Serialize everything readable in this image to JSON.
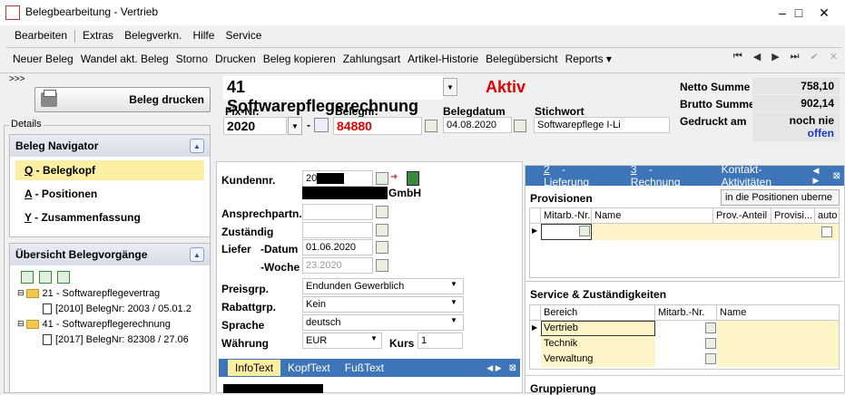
{
  "window": {
    "title": "Belegbearbeitung - Vertrieb",
    "minimize": "–",
    "maximize": "□",
    "close": "✕"
  },
  "menu": [
    "Bearbeiten",
    "Extras",
    "Belegverkn.",
    "Hilfe",
    "Service"
  ],
  "toolbar": [
    "Neuer Beleg",
    "Wandel akt. Beleg",
    "Storno",
    "Drucken",
    "Beleg kopieren",
    "Zahlungsart",
    "Artikel-Historie",
    "Belegübersicht",
    "Reports ▾"
  ],
  "nav": {
    "first": "⏮",
    "prev": "◀",
    "next": "▶",
    "last": "⏭",
    "ok": "✔",
    "cancel": "✕"
  },
  "left": {
    "expander": ">>>",
    "print_label": "Beleg drucken",
    "details_label": "Details",
    "navigator": {
      "title": "Beleg Navigator",
      "items": [
        {
          "key": "Q",
          "label": " - Belegkopf"
        },
        {
          "key": "A",
          "label": " - Positionen"
        },
        {
          "key": "Y",
          "label": " - Zusammenfassung"
        }
      ]
    },
    "overview": {
      "title": "Übersicht Belegvorgänge",
      "tree": [
        "21 - Softwarepflegevertrag",
        "[2010] BelegNr: 2003 / 05.01.2",
        "41 - Softwarepflegerechnung",
        "[2017] BelegNr: 82308 / 27.06"
      ]
    }
  },
  "header": {
    "doc_type": "41 Softwarepflegerechnung",
    "status": "Aktiv",
    "fix_label": "Fix-Nr.",
    "fix_value": "2020",
    "belegnr_label": "Belegnr.",
    "belegnr_value": "84880",
    "belegdatum_label": "Belegdatum",
    "belegdatum_value": "04.08.2020",
    "stichwort_label": "Stichwort",
    "stichwort_value": "Softwarepflege  I-Li",
    "dash": "-"
  },
  "sums": {
    "netto_label": "Netto Summe",
    "netto_value": "758,10",
    "brutto_label": "Brutto Summe",
    "brutto_value": "902,14",
    "gedruckt_label": "Gedruckt am",
    "gedruckt_value1": "noch nie",
    "gedruckt_value2": "offen"
  },
  "customer": {
    "kundennr_label": "Kundennr.",
    "kundennr_value": "20",
    "gmbh": "GmbH",
    "ansprech_label": "Ansprechpartn.",
    "zustaendig_label": "Zuständig",
    "liefer_label": "Liefer",
    "datum_label": "-Datum",
    "datum_value": "01.06.2020",
    "woche_label": "-Woche",
    "woche_value": "23.2020",
    "preisgrp_label": "Preisgrp.",
    "preisgrp_value": "Endunden Gewerblich",
    "rabattgrp_label": "Rabattgrp.",
    "rabattgrp_value": "Kein",
    "sprache_label": "Sprache",
    "sprache_value": "deutsch",
    "waehrung_label": "Währung",
    "waehrung_value": "EUR",
    "kurs_label": "Kurs",
    "kurs_value": "1"
  },
  "infotabs": [
    "InfoText",
    "KopfText",
    "FußText"
  ],
  "right": {
    "tabs": [
      {
        "key": "2",
        "label": " - Lieferung"
      },
      {
        "key": "3",
        "label": " - Rechnung"
      },
      {
        "key": "",
        "label": "Kontakt-Aktivitäten"
      }
    ],
    "provisionen_title": "Provisionen",
    "provisionen_button": "in die Positionen uberne",
    "prov_columns": [
      "Mitarb.-Nr.",
      "Name",
      "Prov.-Anteil",
      "Provisi...",
      "auto"
    ],
    "service_title": "Service & Zuständigkeiten",
    "service_columns": [
      "Bereich",
      "Mitarb.-Nr.",
      "Name"
    ],
    "service_rows": [
      "Vertrieb",
      "Technik",
      "Verwaltung"
    ],
    "gruppierung_title": "Gruppierung"
  }
}
